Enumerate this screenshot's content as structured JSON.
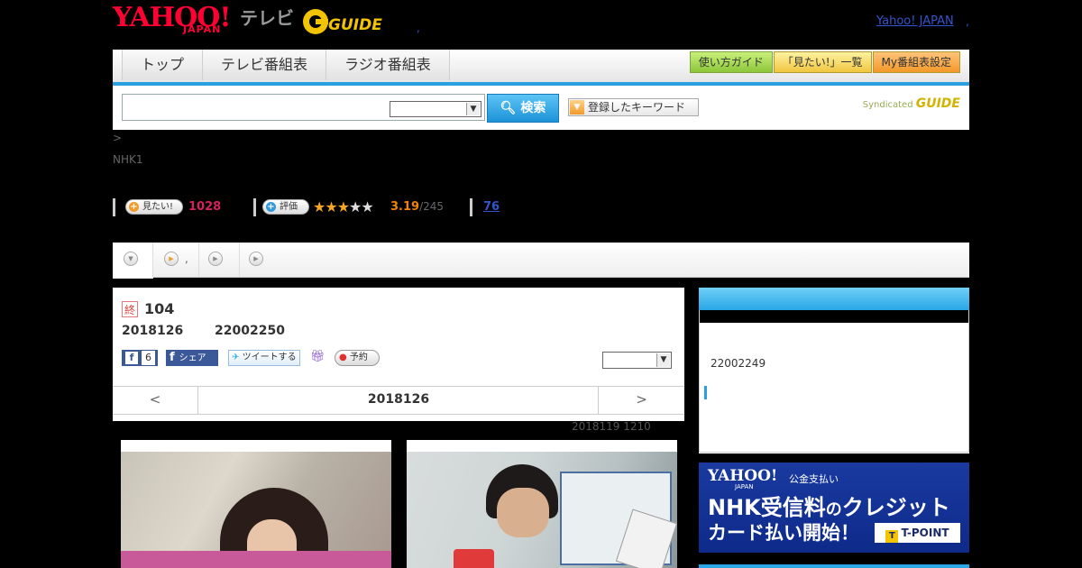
{
  "header": {
    "yahoo_logo": "YAHOO!",
    "japan_label": "JAPAN",
    "tv_label": "テレビ",
    "gguide_logo": "GUIDE",
    "yahoo_japan_link": "Yahoo! JAPAN",
    "separator": ","
  },
  "nav": {
    "tabs": [
      {
        "label": "トップ"
      },
      {
        "label": "テレビ番組表"
      },
      {
        "label": "ラジオ番組表"
      }
    ],
    "right_buttons": [
      {
        "label": "使い方ガイド"
      },
      {
        "label": "「見たい!」一覧"
      },
      {
        "label": "My番組表設定"
      }
    ]
  },
  "search": {
    "input_value": "",
    "select_value": "",
    "button_label": "検索",
    "keyword_button_label": "登録したキーワード",
    "syndicated_label": "Syndicated",
    "syndicated_logo": "GUIDE"
  },
  "breadcrumb": ">",
  "channel": "NHK1",
  "stats": {
    "want_label": "見たい!",
    "want_count": "1028",
    "rate_label": "評価",
    "rating_value": "3.19",
    "rating_total": "/245",
    "rating_stars": 3.19,
    "link_count": "76"
  },
  "subtabs": {
    "separator": ","
  },
  "program": {
    "end_badge": "終",
    "title": "104",
    "air_date": "2018126",
    "air_time": "22002250",
    "fb_like_count": "6",
    "fb_share_label": "シェア",
    "tweet_label": "ツイートする",
    "reserve_label": "予約",
    "select_value": "",
    "date_nav": {
      "prev": "<",
      "current": "2018126",
      "next": ">"
    },
    "updated": "2018119  1210"
  },
  "side": {
    "time": "22002249"
  },
  "banner": {
    "logo": "YAHOO!",
    "japan": "JAPAN",
    "sub": "公金支払い",
    "line1_a": "NHK受信料",
    "line1_b": "の",
    "line1_c": "クレジット",
    "line2": "カード払い開始！",
    "tpoint": "T-POINT",
    "tpoint_mark": "T"
  },
  "colors": {
    "accent_blue": "#2aa0e0",
    "yahoo_red": "#ff0033",
    "want_count": "#d6215d",
    "rating": "#f08300",
    "banner_bg": "#1a3aa0"
  }
}
